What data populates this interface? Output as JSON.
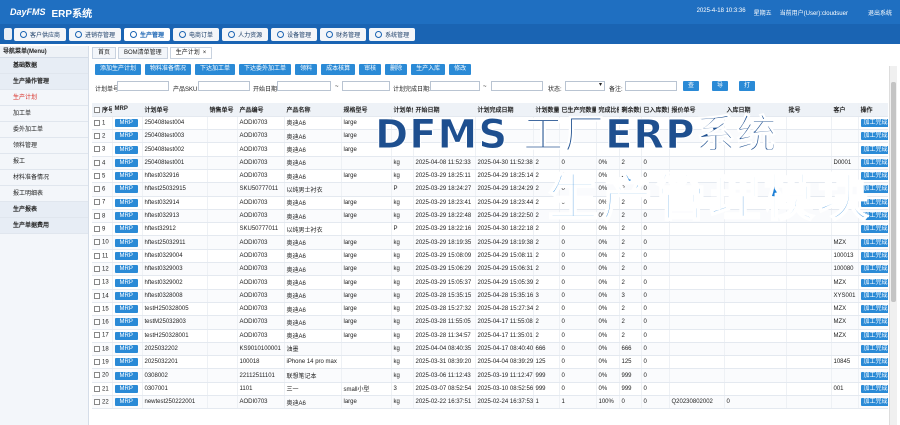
{
  "header": {
    "logo": "DayFMS",
    "system": "ERP系统",
    "datetime": "2025-4-18 10:3:36",
    "weekday": "星期五",
    "user": "当前用户(User):cloudsuer",
    "logout": "退出系统"
  },
  "modules": [
    {
      "label": "客户供应商",
      "icon": "customer-icon"
    },
    {
      "label": "进销存管理",
      "icon": "inventory-icon"
    },
    {
      "label": "生产管理",
      "icon": "production-icon",
      "active": true
    },
    {
      "label": "电商订单",
      "icon": "order-icon"
    },
    {
      "label": "人力资源",
      "icon": "hr-icon"
    },
    {
      "label": "设备管理",
      "icon": "equipment-icon"
    },
    {
      "label": "财务管理",
      "icon": "finance-icon"
    },
    {
      "label": "系统管理",
      "icon": "settings-icon"
    }
  ],
  "sidebar": {
    "title": "导航菜单(Menu)",
    "items": [
      {
        "label": "基础数据",
        "group": true
      },
      {
        "label": "生产操作管理",
        "group": true
      },
      {
        "label": "生产计划",
        "active": true
      },
      {
        "label": "加工单"
      },
      {
        "label": "委外加工单"
      },
      {
        "label": "领料管理"
      },
      {
        "label": "报工"
      },
      {
        "label": "材料准备情况"
      },
      {
        "label": "报工明细表"
      },
      {
        "label": "生产报表",
        "group": true
      },
      {
        "label": "生产单据费用",
        "group": true
      }
    ]
  },
  "crumbs": [
    "首页",
    "BOM清单管理",
    "生产计划"
  ],
  "crumb_close": "×",
  "toolbar": [
    "添加生产计划",
    "物料准备情况",
    "下达加工单",
    "下达委外加工单",
    "领料",
    "成本核算",
    "审核",
    "删除",
    "生产入库",
    "修改"
  ],
  "filters": {
    "plan_no": "计划单号:",
    "product_sku": "产品SKU:",
    "start_date": "开始日期:",
    "tilde": "~",
    "plan_finish_date": "计划完成日期:",
    "status": "状态:",
    "remark": "备注:",
    "query": "查询",
    "export": "导出",
    "print": "打印"
  },
  "table": {
    "columns": [
      "序号",
      "MRP",
      "计划单号",
      "销售单号",
      "产品编号",
      "产品名称",
      "规格型号",
      "计划单位",
      "开始日期",
      "计划完成日期",
      "计划数量",
      "已生产完数量",
      "完成比例",
      "剩余数量",
      "已入库数量",
      "报价单号",
      "入库日期",
      "批号",
      "客户",
      "操作"
    ],
    "mrp_label": "MRP",
    "op_label": "加工完成",
    "rows": [
      [
        "1",
        "250408test004",
        "",
        "AODI0703",
        "奥迪A6",
        "large",
        "",
        "",
        "",
        "",
        "",
        "",
        "",
        "",
        "",
        "",
        "",
        "",
        ""
      ],
      [
        "2",
        "250408test003",
        "",
        "AODI0703",
        "奥迪A6",
        "large",
        "",
        "",
        "",
        "",
        "",
        "",
        "",
        "",
        "",
        "",
        "",
        "",
        ""
      ],
      [
        "3",
        "250408test002",
        "",
        "AODI0703",
        "奥迪A6",
        "large",
        "",
        "",
        "",
        "",
        "",
        "",
        "",
        "",
        "",
        "",
        "",
        "",
        ""
      ],
      [
        "4",
        "250408test001",
        "",
        "AODI0703",
        "奥迪A6",
        "",
        "kg",
        "2025-04-08 11:52:33",
        "2025-04-30 11:52:38",
        "2",
        "0",
        "0%",
        "2",
        "0",
        "",
        "",
        "",
        "D0001",
        ""
      ],
      [
        "5",
        "hftest032916",
        "",
        "AODI0703",
        "奥迪A6",
        "large",
        "kg",
        "2025-03-29 18:25:11",
        "2025-04-29 18:25:14",
        "2",
        "0",
        "0%",
        "2",
        "0",
        "",
        "",
        "",
        "",
        ""
      ],
      [
        "6",
        "hftest25032915",
        "",
        "SKU50777011",
        "以纯男士衬衣",
        "",
        "P",
        "2025-03-29 18:24:27",
        "2025-04-29 18:24:29",
        "2",
        "0",
        "0%",
        "2",
        "0",
        "",
        "",
        "",
        "",
        ""
      ],
      [
        "7",
        "hftest032914",
        "",
        "AODI0703",
        "奥迪A6",
        "large",
        "kg",
        "2025-03-29 18:23:41",
        "2025-04-29 18:23:44",
        "2",
        "0",
        "0%",
        "2",
        "0",
        "",
        "",
        "",
        "",
        ""
      ],
      [
        "8",
        "hftest032913",
        "",
        "AODI0703",
        "奥迪A6",
        "large",
        "kg",
        "2025-03-29 18:22:48",
        "2025-04-29 18:22:50",
        "2",
        "0",
        "0%",
        "2",
        "0",
        "",
        "",
        "",
        "",
        ""
      ],
      [
        "9",
        "hftest32912",
        "",
        "SKU50777011",
        "以纯男士衬衣",
        "",
        "P",
        "2025-03-29 18:22:16",
        "2025-04-30 18:22:18",
        "2",
        "0",
        "0%",
        "2",
        "0",
        "",
        "",
        "",
        "",
        ""
      ],
      [
        "10",
        "hftest25032911",
        "",
        "AODI0703",
        "奥迪A6",
        "large",
        "kg",
        "2025-03-29 18:19:35",
        "2025-04-29 18:19:38",
        "2",
        "0",
        "0%",
        "2",
        "0",
        "",
        "",
        "",
        "MZX",
        ""
      ],
      [
        "11",
        "hftest0329004",
        "",
        "AODI0703",
        "奥迪A6",
        "large",
        "kg",
        "2025-03-29 15:08:09",
        "2025-04-29 15:08:11",
        "2",
        "0",
        "0%",
        "2",
        "0",
        "",
        "",
        "",
        "100013",
        ""
      ],
      [
        "12",
        "hftest0329003",
        "",
        "AODI0703",
        "奥迪A6",
        "large",
        "kg",
        "2025-03-29 15:06:29",
        "2025-04-29 15:06:31",
        "2",
        "0",
        "0%",
        "2",
        "0",
        "",
        "",
        "",
        "100080",
        ""
      ],
      [
        "13",
        "hftest0329002",
        "",
        "AODI0703",
        "奥迪A6",
        "large",
        "kg",
        "2025-03-29 15:05:37",
        "2025-04-29 15:05:39",
        "2",
        "0",
        "0%",
        "2",
        "0",
        "",
        "",
        "",
        "MZX",
        ""
      ],
      [
        "14",
        "hftest0328008",
        "",
        "AODI0703",
        "奥迪A6",
        "large",
        "kg",
        "2025-03-28 15:35:15",
        "2025-04-28 15:35:16",
        "3",
        "0",
        "0%",
        "3",
        "0",
        "",
        "",
        "",
        "XYS001",
        ""
      ],
      [
        "15",
        "testH250328005",
        "",
        "AODI0703",
        "奥迪A6",
        "large",
        "kg",
        "2025-03-28 15:27:32",
        "2025-04-28 15:27:34",
        "2",
        "0",
        "0%",
        "2",
        "0",
        "",
        "",
        "",
        "MZX",
        ""
      ],
      [
        "16",
        "testM25032803",
        "",
        "AODI0703",
        "奥迪A6",
        "large",
        "kg",
        "2025-03-28 11:55:05",
        "2025-04-17 11:55:08",
        "2",
        "0",
        "0%",
        "2",
        "0",
        "",
        "",
        "",
        "MZX",
        ""
      ],
      [
        "17",
        "testH250328001",
        "",
        "AODI0703",
        "奥迪A6",
        "large",
        "kg",
        "2025-03-28 11:34:57",
        "2025-04-17 11:35:01",
        "2",
        "0",
        "0%",
        "2",
        "0",
        "",
        "",
        "",
        "MZX",
        ""
      ],
      [
        "18",
        "2025032202",
        "",
        "KS9010100001",
        "油墨",
        "",
        "kg",
        "2025-04-04 08:40:35",
        "2025-04-17 08:40:40",
        "666",
        "0",
        "0%",
        "666",
        "0",
        "",
        "",
        "",
        "",
        ""
      ],
      [
        "19",
        "2025032201",
        "",
        "100018",
        "iPhone 14 pro max",
        "",
        "kg",
        "2025-03-31 08:39:20",
        "2025-04-04 08:39:29",
        "125",
        "0",
        "0%",
        "125",
        "0",
        "",
        "",
        "",
        "10845",
        ""
      ],
      [
        "20",
        "0308002",
        "",
        "22112511101",
        "联想笔记本",
        "",
        "kg",
        "2025-03-06 11:12:43",
        "2025-03-19 11:12:47",
        "999",
        "0",
        "0%",
        "999",
        "0",
        "",
        "",
        "",
        "",
        ""
      ],
      [
        "21",
        "0307001",
        "",
        "1101",
        "三一",
        "small小型",
        "3",
        "2025-03-07 08:52:54",
        "2025-03-10 08:52:56",
        "999",
        "0",
        "0%",
        "999",
        "0",
        "",
        "",
        "",
        "001",
        ""
      ],
      [
        "22",
        "newtest250222001",
        "",
        "AODI0703",
        "奥迪A6",
        "large",
        "kg",
        "2025-02-22 16:37:51",
        "2025-02-24 16:37:53",
        "1",
        "1",
        "100%",
        "0",
        "0",
        "Q20230802002",
        "0",
        "",
        "",
        ""
      ]
    ]
  },
  "overlay": {
    "line1": "DFMS 工厂ERP系统",
    "line2": "生产管理模块"
  }
}
